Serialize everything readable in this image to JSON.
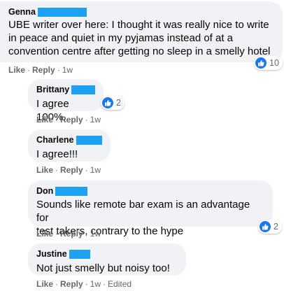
{
  "comments": [
    {
      "author": "Genna",
      "text": "UBE writer over here: I thought it was really nice to write\nin peace and quiet in my pyjamas instead of at a\nconvention centre after getting no sleep in a smelly hotel",
      "reactions": "10",
      "like": "Like",
      "reply": "Reply",
      "time": "1w"
    },
    {
      "author": "Brittany",
      "text": "I agree 100%.",
      "reactions": "2",
      "like": "Like",
      "reply": "Reply",
      "time": "1w"
    },
    {
      "author": "Charlene",
      "text": "I agree!!!",
      "like": "Like",
      "reply": "Reply",
      "time": "1w"
    },
    {
      "author": "Don",
      "text": "Sounds like remote bar exam is an advantage for\ntest takers, contrary to the hype",
      "reactions": "2",
      "like": "Like",
      "reply": "Reply",
      "time": "1w"
    },
    {
      "author": "Justine",
      "text": "Not just smelly but noisy too!",
      "like": "Like",
      "reply": "Reply",
      "time": "1w",
      "edited": "Edited"
    }
  ],
  "colors": {
    "bubble": "#f0f2f5",
    "redaction": "#1da1f2",
    "like_blue": "#1877f2",
    "meta_gray": "#65676b"
  }
}
